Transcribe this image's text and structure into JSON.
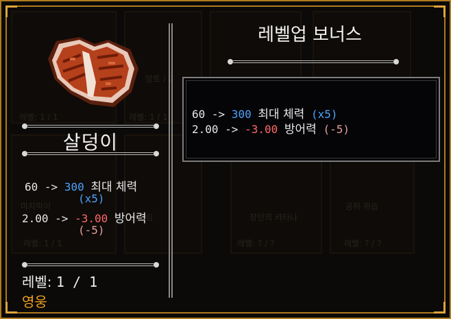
{
  "item": {
    "name": "살덩이",
    "stats": [
      {
        "from": "60",
        "arrow": "->",
        "to": "300",
        "label": "최대 체력",
        "delta": "(x5)"
      },
      {
        "from": "2.00",
        "arrow": "->",
        "to": "-3.00",
        "label": "방어력",
        "delta": "(-5)"
      }
    ],
    "level_label": "레벨:",
    "level_value": "1 / 1",
    "rarity": "영웅"
  },
  "bonus": {
    "title": "레벨업 보너스",
    "lines": [
      {
        "from": "60",
        "arrow": "->",
        "to": "300",
        "label": "최대 체력",
        "delta": "(x5)"
      },
      {
        "from": "2.00",
        "arrow": "->",
        "to": "-3.00",
        "label": "방어력",
        "delta": "(-5)"
      }
    ]
  },
  "background_cards": {
    "labels": [
      "레벨: 1 / 1",
      "망토 / 2",
      "레벨: 1 / 1",
      "마지막이",
      "손그림",
      "장인의 카타나",
      "공허 위습",
      "레벨: 1 / 1",
      "레벨: ? / ?",
      "레벨: ? / ?"
    ]
  },
  "colors": {
    "frame": "#b07a1e",
    "positive": "#4ea3ff",
    "negative": "#ff6a6a",
    "delta_negative": "#e8a0a0",
    "rarity_hero": "#f0a020"
  },
  "icons": {
    "item": "meat-steak-icon"
  }
}
